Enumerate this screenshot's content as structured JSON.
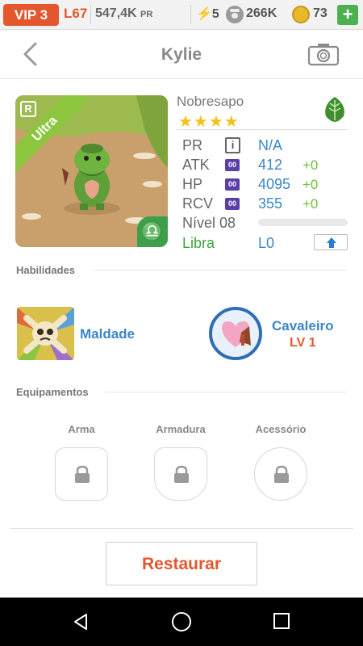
{
  "status_bar": {
    "vip": "VIP 3",
    "level": "L67",
    "power": "547,4K",
    "power_unit": "PR",
    "energy": "5",
    "paws": "266K",
    "coins": "73",
    "add": "+"
  },
  "header": {
    "title": "Kylie"
  },
  "creature": {
    "rarity_letter": "R",
    "rarity": "Ultra",
    "species": "Nobresapo",
    "stars": "★★★★",
    "element_icon": "leaf-icon",
    "zodiac_glyph": "♎"
  },
  "stats": {
    "pr": {
      "label": "PR",
      "value": "N/A"
    },
    "atk": {
      "label": "ATK",
      "value": "412",
      "bonus": "+0"
    },
    "hp": {
      "label": "HP",
      "value": "4095",
      "bonus": "+0"
    },
    "rcv": {
      "label": "RCV",
      "value": "355",
      "bonus": "+0"
    },
    "tag": "00",
    "info": "i",
    "level_label": "Nível 08",
    "xp_progress": 0,
    "sign": "Libra",
    "sign_level": "L0"
  },
  "abilities": {
    "title": "Habilidades",
    "items": [
      {
        "name": "Maldade"
      },
      {
        "name": "Cavaleiro",
        "level": "LV 1"
      }
    ]
  },
  "equipment": {
    "title": "Equipamentos",
    "slots": [
      {
        "label": "Arma"
      },
      {
        "label": "Armadura"
      },
      {
        "label": "Acessório"
      }
    ]
  },
  "actions": {
    "restore": "Restaurar"
  }
}
